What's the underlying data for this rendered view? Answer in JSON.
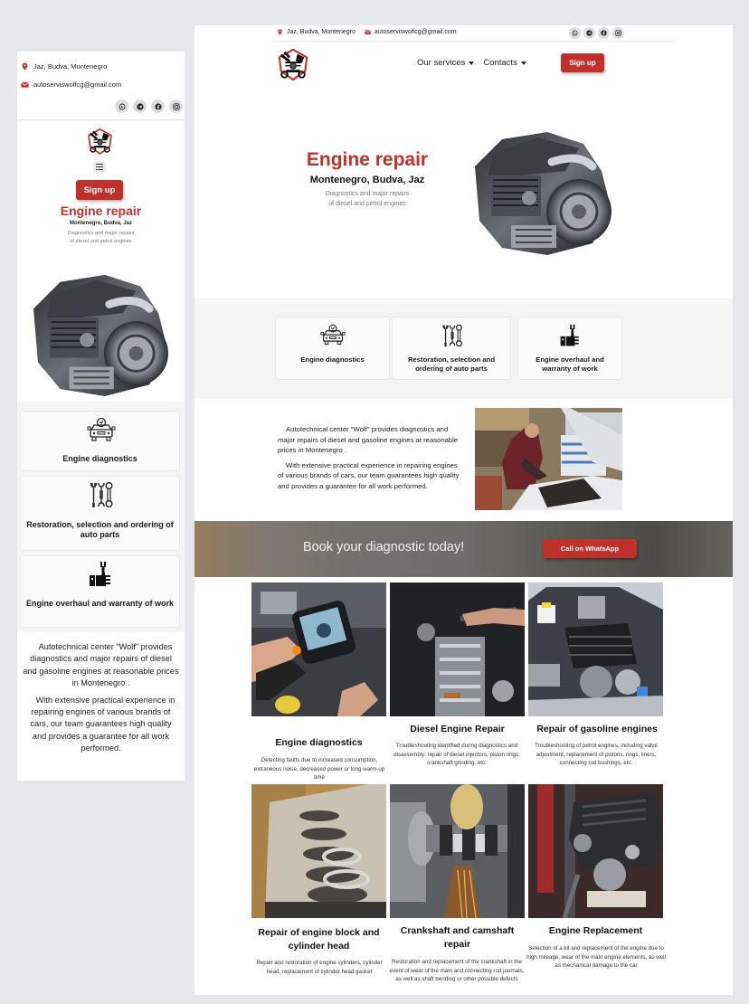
{
  "contact": {
    "address": "Jaz, Budva, Montenegro",
    "email": "autoserviswolfcg@gmail.com"
  },
  "social": [
    "whatsapp-icon",
    "telegram-icon",
    "facebook-icon",
    "instagram-icon"
  ],
  "colors": {
    "accent": "#c0312b",
    "page_bg": "#e6e7ea",
    "feature_bg": "#f5f5f5"
  },
  "nav": {
    "items": [
      {
        "label": "Our services",
        "has_dropdown": true
      },
      {
        "label": "Contacts",
        "has_dropdown": true
      }
    ],
    "signup_label": "Sign up"
  },
  "hero": {
    "title": "Engine repair",
    "subtitle": "Montenegro, Budva, Jaz",
    "desc_line1": "Diagnostics and major repairs",
    "desc_line2": "of diesel and petrol engines"
  },
  "features": [
    {
      "label": "Engine diagnostics",
      "icon": "car-diagnostics-icon"
    },
    {
      "label": "Restoration, selection and ordering of auto parts",
      "icon": "wrenches-icon"
    },
    {
      "label": "Engine overhaul and warranty of work",
      "icon": "thumbs-up-wrench-icon"
    }
  ],
  "about": {
    "p1": "Autotechnical center \"Wolf\" provides diagnostics and major repairs of diesel and gasoline engines  at reasonable prices  in Montenegro .",
    "p2": "With extensive practical experience in repairing engines of various brands of cars, our team guarantees high quality and provides a guarantee for all work performed."
  },
  "banner": {
    "text": "Book your diagnostic today!",
    "button": "Call on WhatsApp"
  },
  "services": [
    {
      "title": "Engine diagnostics",
      "desc": "Detecting faults due to increased consumption, extraneous noise, decreased power or long warm-up time"
    },
    {
      "title": "Diesel Engine Repair",
      "desc": "Troubleshooting identified during diagnostics and disassembly: repair of diesel injectors, piston rings, crankshaft grinding, etc."
    },
    {
      "title": "Repair of gasoline engines",
      "desc": "Troubleshooting of petrol engines, including valve adjustment, replacement of pistons, rings, liners, connecting rod bushings, etc."
    },
    {
      "title": "Repair of engine block and cylinder head",
      "desc": "Repair and restoration of engine cylinders, cylinder head, replacement of cylinder head gasket"
    },
    {
      "title": "Crankshaft and camshaft repair",
      "desc": "Restoration and replacement of the crankshaft in the event of wear of the main and connecting rod journals, as well as shaft bending or other possible defects"
    },
    {
      "title": "Engine Replacement",
      "desc": "Selection of a kit and replacement of the engine due to high mileage, wear of the main engine elements, as well as mechanical damage to the car"
    }
  ]
}
